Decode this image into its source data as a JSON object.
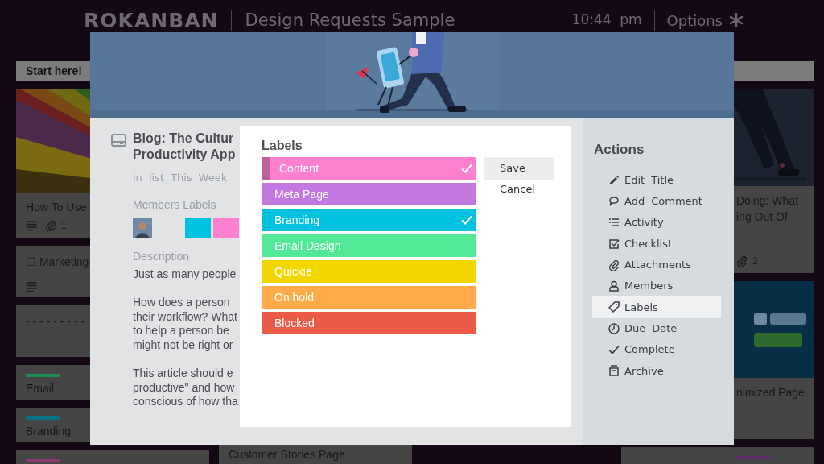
{
  "topbar": {
    "logo": "ROKANBAN",
    "board_title": "Design Requests Sample",
    "time": "10:44 pm",
    "options": "Options"
  },
  "lists": [
    {
      "title": "Start here!",
      "cards": [
        {
          "cover": true,
          "title": "How To Use",
          "description_icon": true,
          "attachments": "1"
        },
        {
          "title": "☐ Marketing",
          "description_icon": true
        },
        {
          "title": "- - - - - - - - -"
        },
        {
          "color": "#1e8c52",
          "title": "Email"
        },
        {
          "color": "#0b6f82",
          "title": "Branding"
        },
        {
          "color": "#8e3b72"
        }
      ]
    },
    {
      "cards": [
        {
          "title": "Customer Stories Page"
        }
      ]
    },
    {
      "cards": [
        {
          "cover": true,
          "title": "Doing: What\ning Out Of",
          "attachments": "2"
        },
        {
          "cover": true,
          "title": "nimized Page"
        },
        {
          "color": "#5d2a6e"
        }
      ]
    }
  ],
  "card_detail": {
    "title": "Blog: The Cultur\nProductivity App",
    "list_info": "in list This Week",
    "members_heading": "Members",
    "labels_heading": "Labels",
    "labels": [
      {
        "color": "#00c2e0"
      },
      {
        "color": "#ff80ce"
      }
    ],
    "description_heading": "Description",
    "description": [
      "Just as many people",
      "How does a person\ntheir workflow? What\nto help a person be\nmight not be right or",
      "This article should e\nproductive\" and how\nconscious of how tha"
    ]
  },
  "labels_popup": {
    "title": "Labels",
    "labels": [
      {
        "name": "Content",
        "color": "#ff80ce",
        "checked": true,
        "selected": true
      },
      {
        "name": "Meta Page",
        "color": "#c377e0",
        "checked": false,
        "selected": false
      },
      {
        "name": "Branding",
        "color": "#00c2e0",
        "checked": true,
        "selected": false
      },
      {
        "name": "Email Design",
        "color": "#51e898",
        "checked": false,
        "selected": false
      },
      {
        "name": "Quickie",
        "color": "#f2d600",
        "checked": false,
        "selected": false
      },
      {
        "name": "On hold",
        "color": "#ffab4a",
        "checked": false,
        "selected": false
      },
      {
        "name": "Blocked",
        "color": "#eb5a46",
        "checked": false,
        "selected": false
      }
    ],
    "save": "Save",
    "cancel": "Cancel"
  },
  "actions": {
    "title": "Actions",
    "items": [
      {
        "label": "Edit Title",
        "selected": false
      },
      {
        "label": "Add Comment",
        "selected": false
      },
      {
        "label": "Activity",
        "selected": false
      },
      {
        "label": "Checklist",
        "selected": false
      },
      {
        "label": "Attachments",
        "selected": false
      },
      {
        "label": "Members",
        "selected": false
      },
      {
        "label": "Labels",
        "selected": true
      },
      {
        "label": "Due Date",
        "selected": false
      },
      {
        "label": "Complete",
        "selected": false
      },
      {
        "label": "Archive",
        "selected": false
      }
    ]
  }
}
